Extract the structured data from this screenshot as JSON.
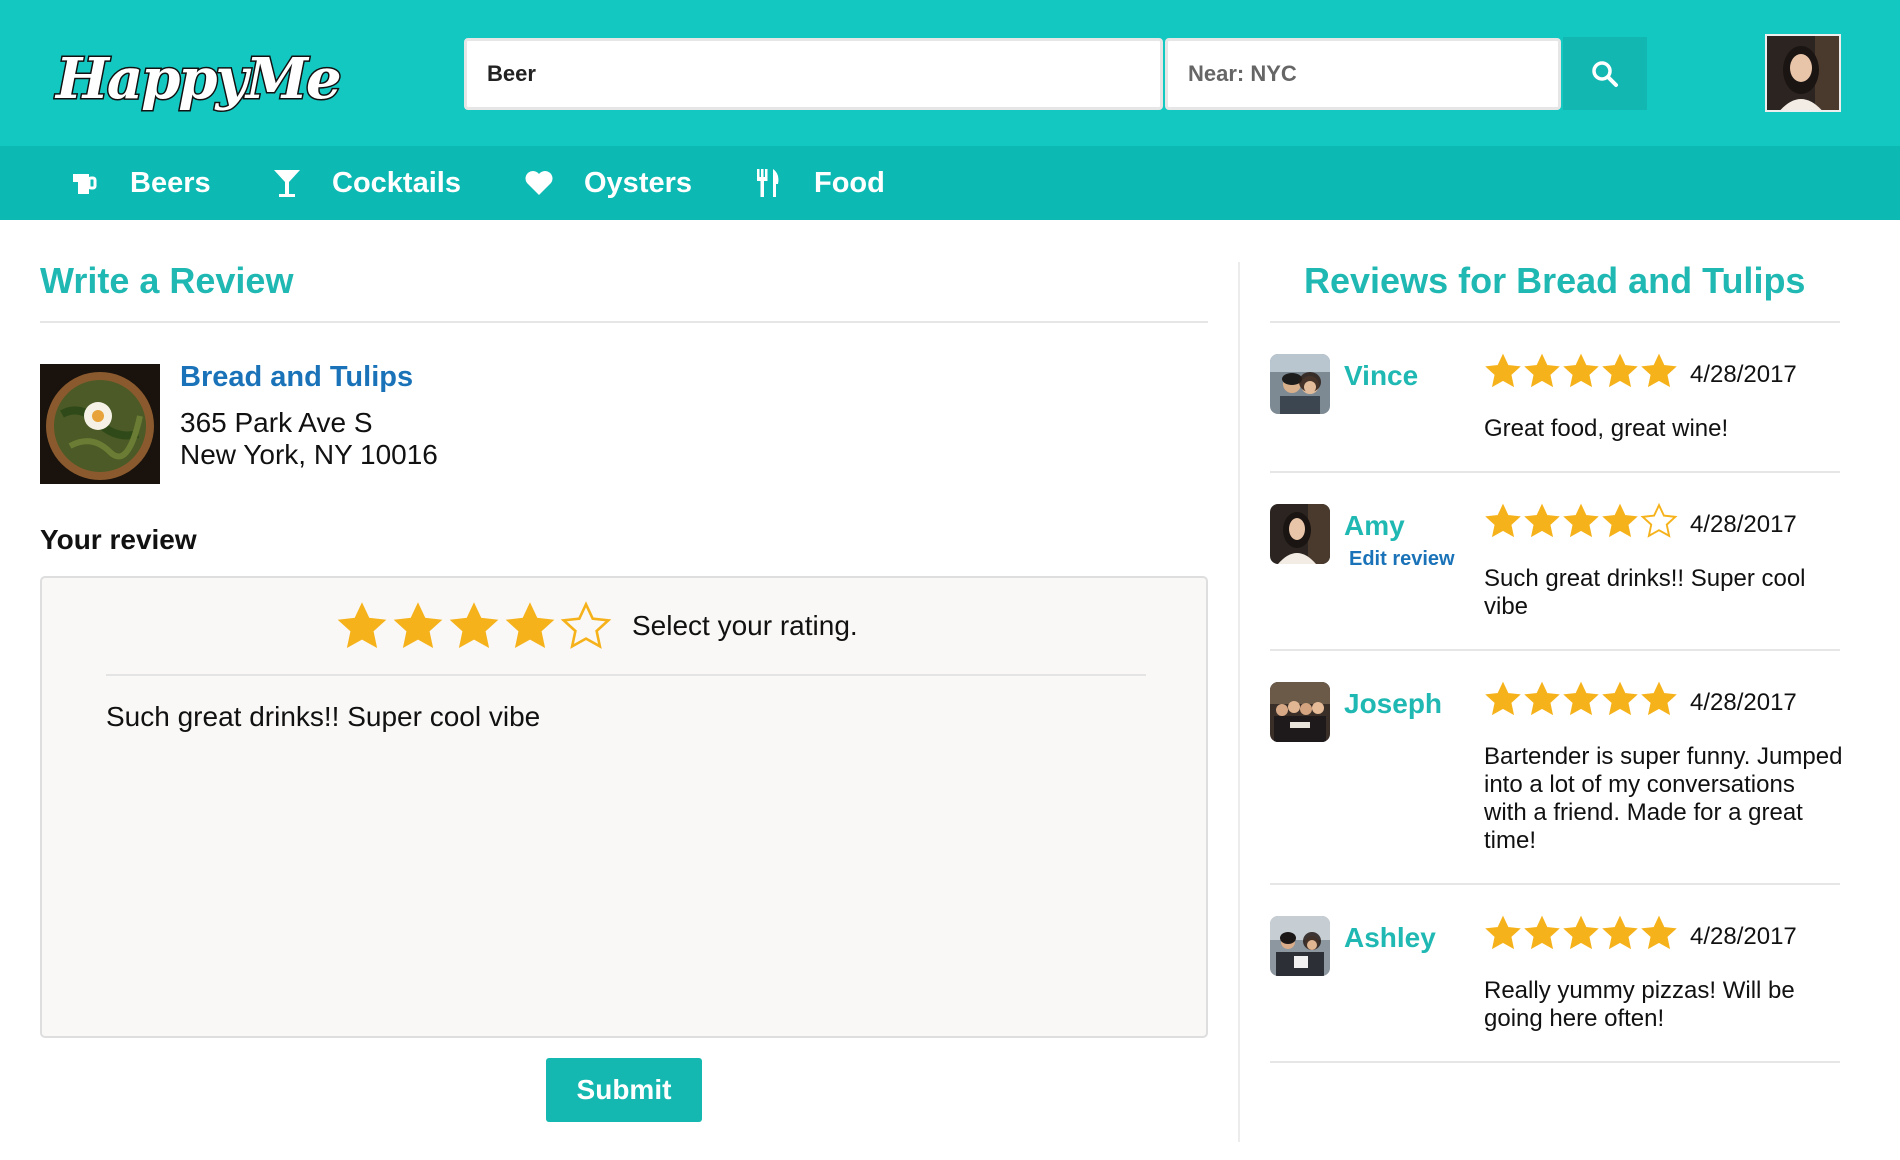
{
  "app": {
    "logo_text": "HappyMe"
  },
  "search": {
    "query": "Beer",
    "near": "Near: NYC"
  },
  "nav": [
    {
      "label": "Beers",
      "icon": "beer-mug-icon"
    },
    {
      "label": "Cocktails",
      "icon": "cocktail-glass-icon"
    },
    {
      "label": "Oysters",
      "icon": "heart-icon"
    },
    {
      "label": "Food",
      "icon": "fork-knife-icon"
    }
  ],
  "write_review": {
    "title": "Write a Review",
    "business": {
      "name": "Bread and Tulips",
      "address_line1": "365 Park Ave S",
      "address_line2": "New York, NY 10016"
    },
    "your_review_label": "Your review",
    "rating": 4,
    "rating_max": 5,
    "rating_hint": "Select your rating.",
    "text": "Such great drinks!! Super cool vibe",
    "submit_label": "Submit"
  },
  "reviews": {
    "title": "Reviews for Bread and Tulips",
    "items": [
      {
        "name": "Vince",
        "rating": 5,
        "date": "4/28/2017",
        "text": "Great food, great wine!"
      },
      {
        "name": "Amy",
        "edit_label": "Edit review",
        "rating": 4,
        "date": "4/28/2017",
        "text": "Such great drinks!! Super cool vibe"
      },
      {
        "name": "Joseph",
        "rating": 5,
        "date": "4/28/2017",
        "text": "Bartender is super funny. Jumped into a lot of my conversations with a friend. Made for a great time!"
      },
      {
        "name": "Ashley",
        "rating": 5,
        "date": "4/28/2017",
        "text": "Really yummy pizzas! Will be going here often!"
      }
    ]
  },
  "colors": {
    "header_bg": "#14c8c2",
    "nav_bg": "#0cb9b3",
    "accent_teal": "#1fb8b2",
    "link_blue": "#1a73b8",
    "star_gold": "#f6b21b"
  }
}
